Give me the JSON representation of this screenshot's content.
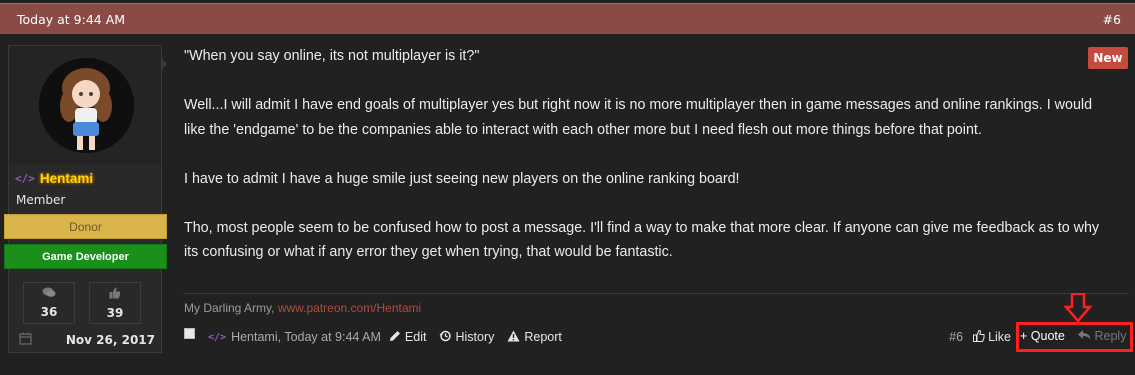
{
  "header": {
    "timestamp": "Today at 9:44 AM",
    "post_number": "#6"
  },
  "user": {
    "name": "Hentami",
    "title": "Member",
    "banners": [
      "Donor",
      "Game Developer"
    ],
    "stats": {
      "messages": "36",
      "likes": "39"
    },
    "joined": "Nov 26, 2017"
  },
  "badge": "New",
  "message": {
    "paragraphs": [
      "\"When you say online, its not multiplayer is it?\"",
      "Well...I will admit I have end goals of multiplayer yes but right now it is no more multiplayer then in game messages and online rankings. I would like the 'endgame' to be the companies able to interact with each other more but I need flesh out more things before that point.",
      "I have to admit I have a huge smile just seeing new players on the online ranking board!",
      "Tho, most people seem to be confused how to post a message. I'll find a way to make that more clear. If anyone can give me feedback as to why its confusing or what if any error they get when trying, that would be fantastic."
    ]
  },
  "signature": {
    "text": "My Darling Army,",
    "link": "www.patreon.com/Hentami"
  },
  "footer": {
    "meta": "Hentami, Today at 9:44 AM",
    "edit": "Edit",
    "history": "History",
    "report": "Report",
    "post_number": "#6",
    "like": "Like",
    "quote": "+ Quote",
    "reply": "Reply"
  },
  "icons": [
    "code-icon",
    "comments-icon",
    "thumbs-up-icon",
    "calendar-icon",
    "pencil-icon",
    "history-icon",
    "warning-icon",
    "reply-icon",
    "arrow-down-icon"
  ],
  "colors": {
    "header_bg": "#8a4b46",
    "username": "#ffd700",
    "donor": "#d9b44a",
    "game_dev": "#1a8f1a",
    "new_badge": "#c44b3e",
    "highlight": "#ff1f1f"
  }
}
